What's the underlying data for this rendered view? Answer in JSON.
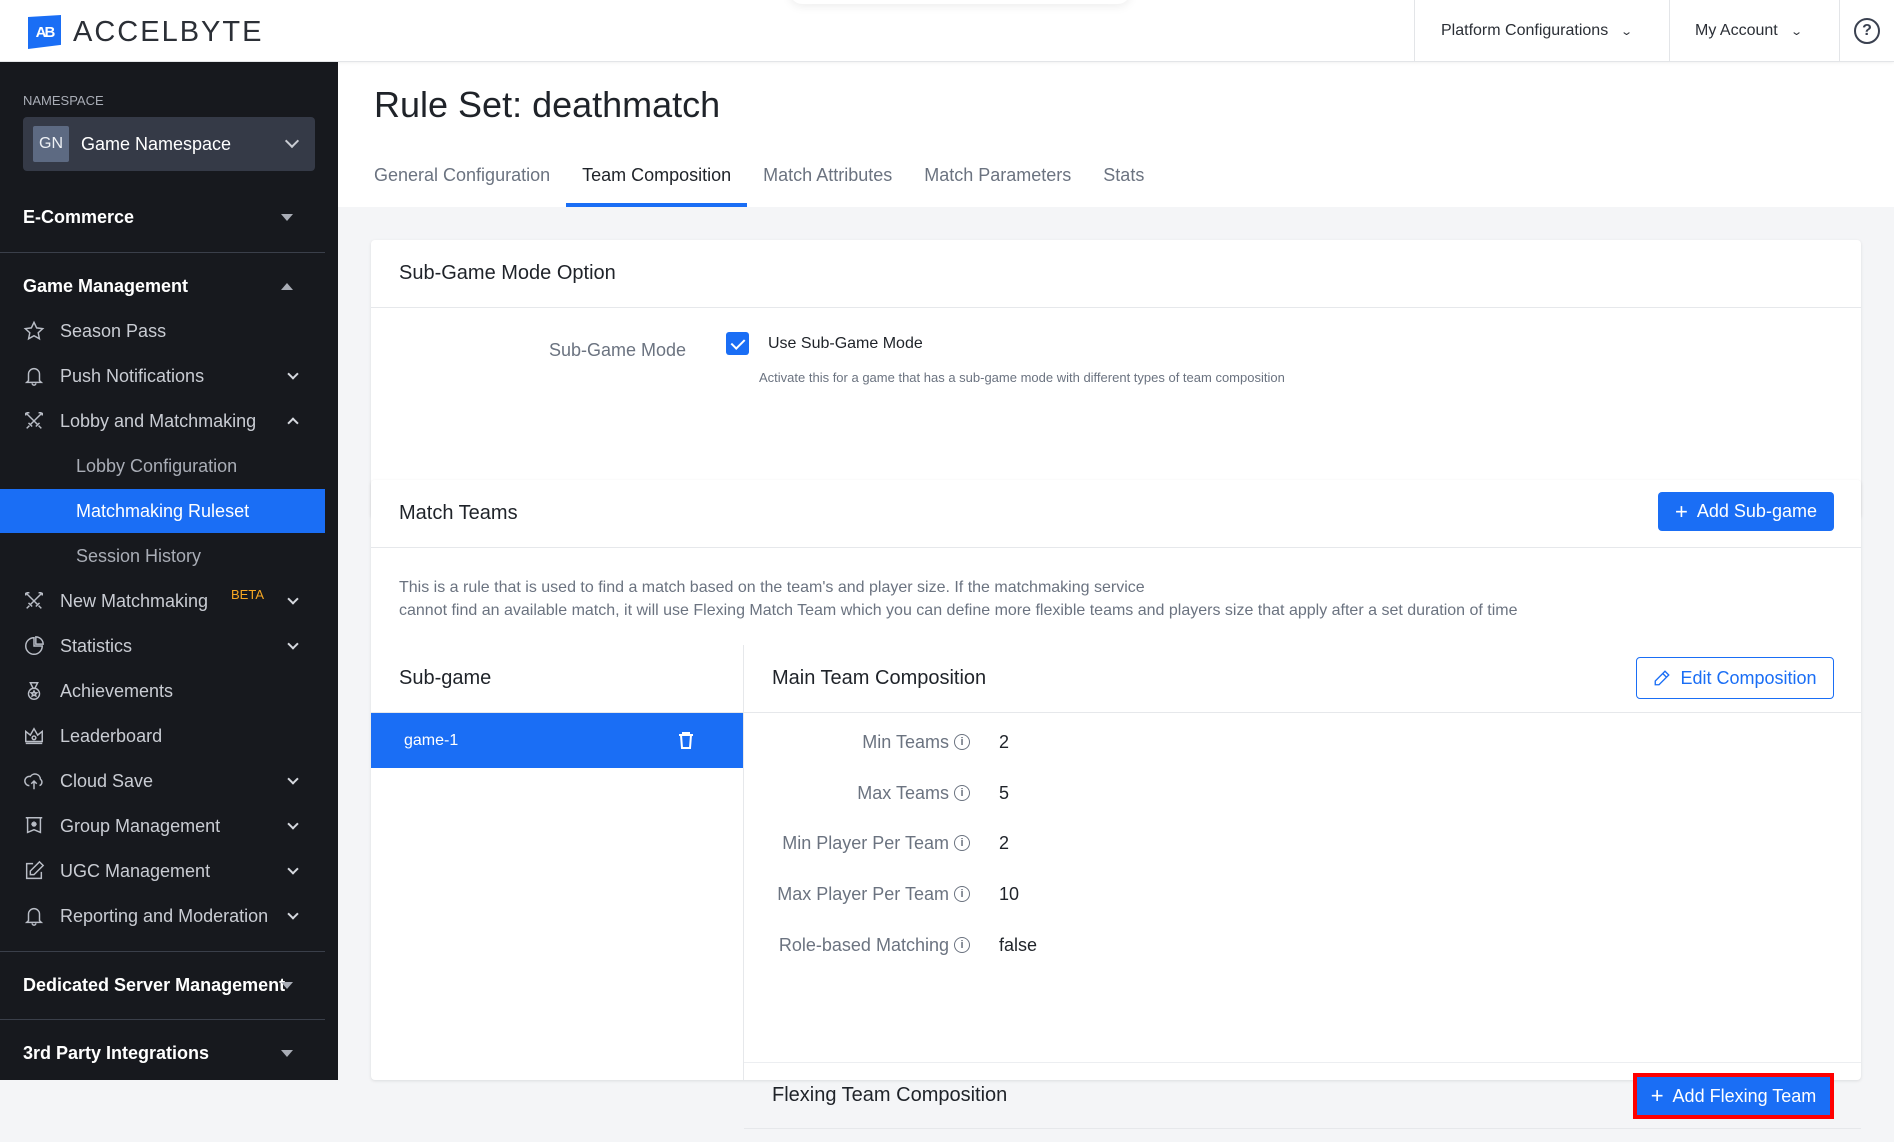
{
  "header": {
    "logo_mark": "AB",
    "logo_text": "ACCELBYTE",
    "menus": [
      {
        "label": "Platform Configurations"
      },
      {
        "label": "My Account"
      }
    ],
    "help_icon": "?"
  },
  "sidebar": {
    "namespace_label": "NAMESPACE",
    "namespace_badge": "GN",
    "namespace_name": "Game Namespace",
    "sections": {
      "ecommerce": "E-Commerce",
      "game_management": "Game Management",
      "dedicated_server": "Dedicated Server Management",
      "third_party": "3rd Party Integrations"
    },
    "items": [
      {
        "label": "Season Pass",
        "icon": "star-icon"
      },
      {
        "label": "Push Notifications",
        "icon": "bell-icon"
      },
      {
        "label": "Lobby and Matchmaking",
        "icon": "crossed-swords-icon"
      },
      {
        "label": "New Matchmaking",
        "icon": "crossed-swords-icon",
        "badge": "BETA"
      },
      {
        "label": "Statistics",
        "icon": "pie-chart-icon"
      },
      {
        "label": "Achievements",
        "icon": "medal-icon"
      },
      {
        "label": "Leaderboard",
        "icon": "crown-icon"
      },
      {
        "label": "Cloud Save",
        "icon": "cloud-upload-icon"
      },
      {
        "label": "Group Management",
        "icon": "banner-icon"
      },
      {
        "label": "UGC Management",
        "icon": "edit-icon"
      },
      {
        "label": "Reporting and Moderation",
        "icon": "bell-icon"
      }
    ],
    "sub_items": [
      {
        "label": "Lobby Configuration"
      },
      {
        "label": "Matchmaking Ruleset",
        "active": true
      },
      {
        "label": "Session History"
      }
    ]
  },
  "main": {
    "title": "Rule Set: deathmatch",
    "tabs": [
      {
        "label": "General Configuration"
      },
      {
        "label": "Team Composition",
        "active": true
      },
      {
        "label": "Match Attributes"
      },
      {
        "label": "Match Parameters"
      },
      {
        "label": "Stats"
      }
    ],
    "sub_game_mode_card": {
      "title": "Sub-Game Mode Option",
      "field_label": "Sub-Game Mode",
      "checkbox_label": "Use Sub-Game Mode",
      "checked": true,
      "help_text": "Activate this for a game that has a sub-game mode with different types of team composition"
    },
    "match_teams_card": {
      "title": "Match Teams",
      "add_sub_game_label": "Add Sub-game",
      "description_line1": "This is a rule that is used to find a match based on the team's and player size. If the matchmaking service",
      "description_line2": "cannot find an available match, it will use Flexing Match Team which you can define more flexible teams and players size that apply after a set duration of time",
      "sub_game_header": "Sub-game",
      "sub_games": [
        {
          "name": "game-1",
          "selected": true
        }
      ],
      "main_team_composition": {
        "title": "Main Team Composition",
        "edit_label": "Edit Composition",
        "fields": [
          {
            "label": "Min Teams",
            "value": "2"
          },
          {
            "label": "Max Teams",
            "value": "5"
          },
          {
            "label": "Min Player Per Team",
            "value": "2"
          },
          {
            "label": "Max Player Per Team",
            "value": "10"
          },
          {
            "label": "Role-based Matching",
            "value": "false"
          }
        ]
      },
      "flexing_team_composition": {
        "title": "Flexing Team Composition",
        "add_label": "Add Flexing Team"
      }
    }
  },
  "colors": {
    "accent": "#1a6ef5",
    "sidebar_bg": "#17191e",
    "highlight_border": "#ff0000",
    "beta": "#f5a623"
  }
}
